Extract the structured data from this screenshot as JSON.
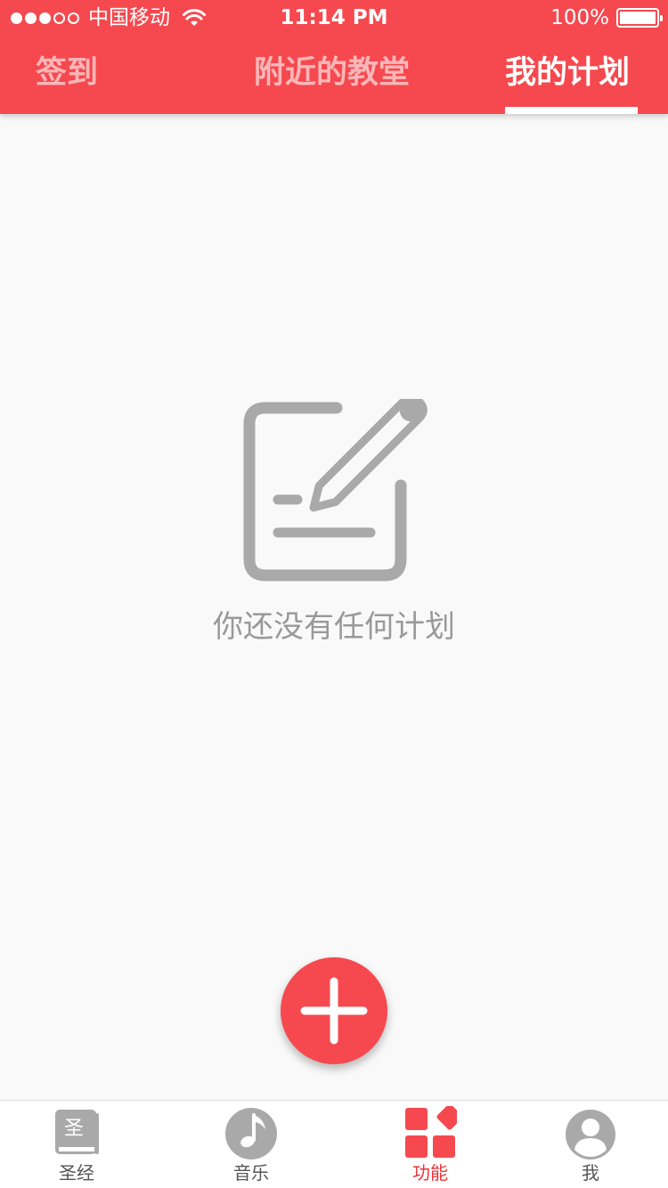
{
  "status_bar": {
    "carrier": "中国移动",
    "time": "11:14 PM",
    "battery": "100%",
    "battery_level": 1.0,
    "signal_bars_filled": 3,
    "signal_bars_total": 5
  },
  "tabs": [
    {
      "label": "签到",
      "active": false
    },
    {
      "label": "附近的教堂",
      "active": false
    },
    {
      "label": "我的计划",
      "active": true
    }
  ],
  "empty_state": {
    "icon": "edit-note-icon",
    "message": "你还没有任何计划"
  },
  "fab": {
    "icon": "plus-icon"
  },
  "bottom_nav": [
    {
      "label": "圣经",
      "icon": "bible-book-icon",
      "icon_glyph": "圣",
      "active": false
    },
    {
      "label": "音乐",
      "icon": "music-note-icon",
      "active": false
    },
    {
      "label": "功能",
      "icon": "grid-icon",
      "active": true
    },
    {
      "label": "我",
      "icon": "user-icon",
      "active": false
    }
  ],
  "colors": {
    "primary": "#f5494f",
    "active_label": "#e8343a",
    "icon_gray": "#a9a9a9",
    "background": "#f9f9f9"
  }
}
